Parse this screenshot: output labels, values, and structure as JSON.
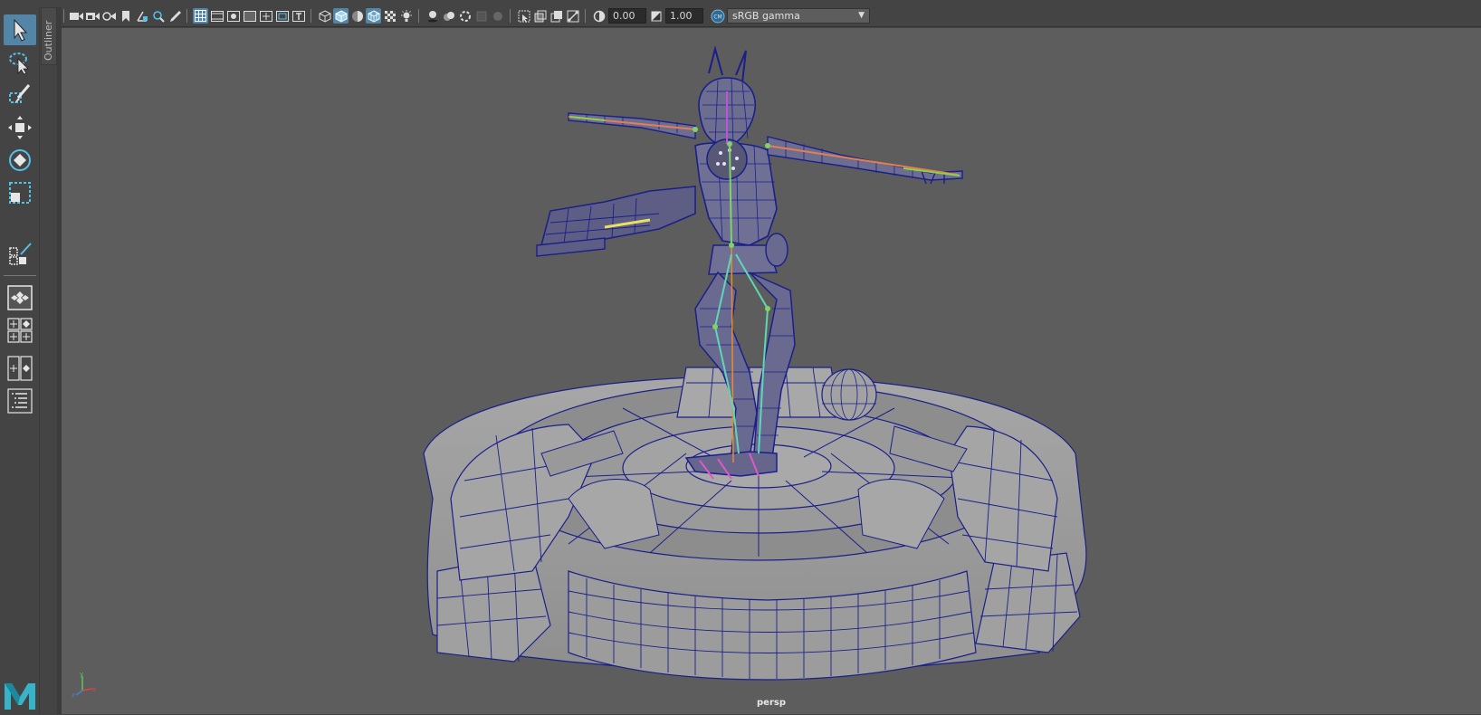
{
  "outliner": {
    "label": "Outliner"
  },
  "toolbar": {
    "exposure_value": "0.00",
    "gamma_value": "1.00",
    "color_space": "sRGB gamma"
  },
  "viewport": {
    "camera": "persp"
  },
  "colors": {
    "accent": "#5285a6",
    "viewport_bg": "#5d5d5d",
    "wire_blue": "#1a1f8a"
  },
  "tools": [
    {
      "name": "select-tool-icon"
    },
    {
      "name": "lasso-tool-icon"
    },
    {
      "name": "paint-select-tool-icon"
    },
    {
      "name": "move-tool-icon"
    },
    {
      "name": "rotate-tool-icon"
    },
    {
      "name": "scale-tool-icon"
    },
    {
      "name": "last-tool-icon"
    },
    {
      "name": "single-layout-icon"
    },
    {
      "name": "four-view-layout-icon"
    },
    {
      "name": "two-view-layout-icon"
    },
    {
      "name": "outliner-layout-icon"
    }
  ]
}
